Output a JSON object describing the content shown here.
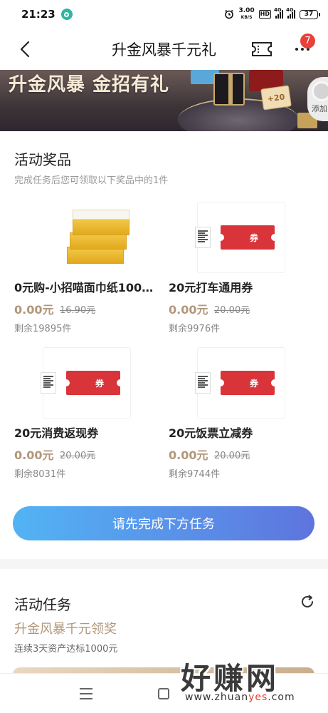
{
  "status_bar": {
    "time": "21:23",
    "speed_value": "3.00",
    "speed_unit": "KB/S",
    "hd": "HD",
    "network1": "4G",
    "network2": "4G",
    "battery": "37"
  },
  "nav": {
    "title": "升金风暴千元礼",
    "badge_count": "7"
  },
  "banner": {
    "headline": "升金风暴 金招有礼",
    "coupon_text": "+20",
    "fab_label": "添加"
  },
  "prizes": {
    "title": "活动奖品",
    "subtitle": "完成任务后您可领取以下奖品中的1件",
    "items": [
      {
        "name": "0元购-小招喵面巾纸1000...",
        "price": "0.00元",
        "original": "16.90元",
        "stock": "剩余19895件",
        "image": "tissue-box-icon"
      },
      {
        "name": "20元打车通用券",
        "price": "0.00元",
        "original": "20.00元",
        "stock": "剩余9976件",
        "image": "coupon-icon",
        "coupon_label": "券"
      },
      {
        "name": "20元消费返现券",
        "price": "0.00元",
        "original": "20.00元",
        "stock": "剩余8031件",
        "image": "coupon-icon",
        "coupon_label": "券"
      },
      {
        "name": "20元饭票立减券",
        "price": "0.00元",
        "original": "20.00元",
        "stock": "剩余9744件",
        "image": "coupon-icon",
        "coupon_label": "券"
      }
    ]
  },
  "action_button": "请先完成下方任务",
  "tasks": {
    "title": "活动任务",
    "name": "升金风暴千元领奖",
    "description": "连续3天资产达标1000元"
  },
  "watermark": {
    "big": "好赚网",
    "small_prefix": "www.zhuan",
    "small_highlight": "yes",
    "small_suffix": ".com"
  },
  "colors": {
    "accent_gold": "#b1977a",
    "button_gradient_start": "#52b4f4",
    "button_gradient_end": "#5e74de",
    "coupon_red": "#d9343a",
    "badge_red": "#e8403a"
  }
}
